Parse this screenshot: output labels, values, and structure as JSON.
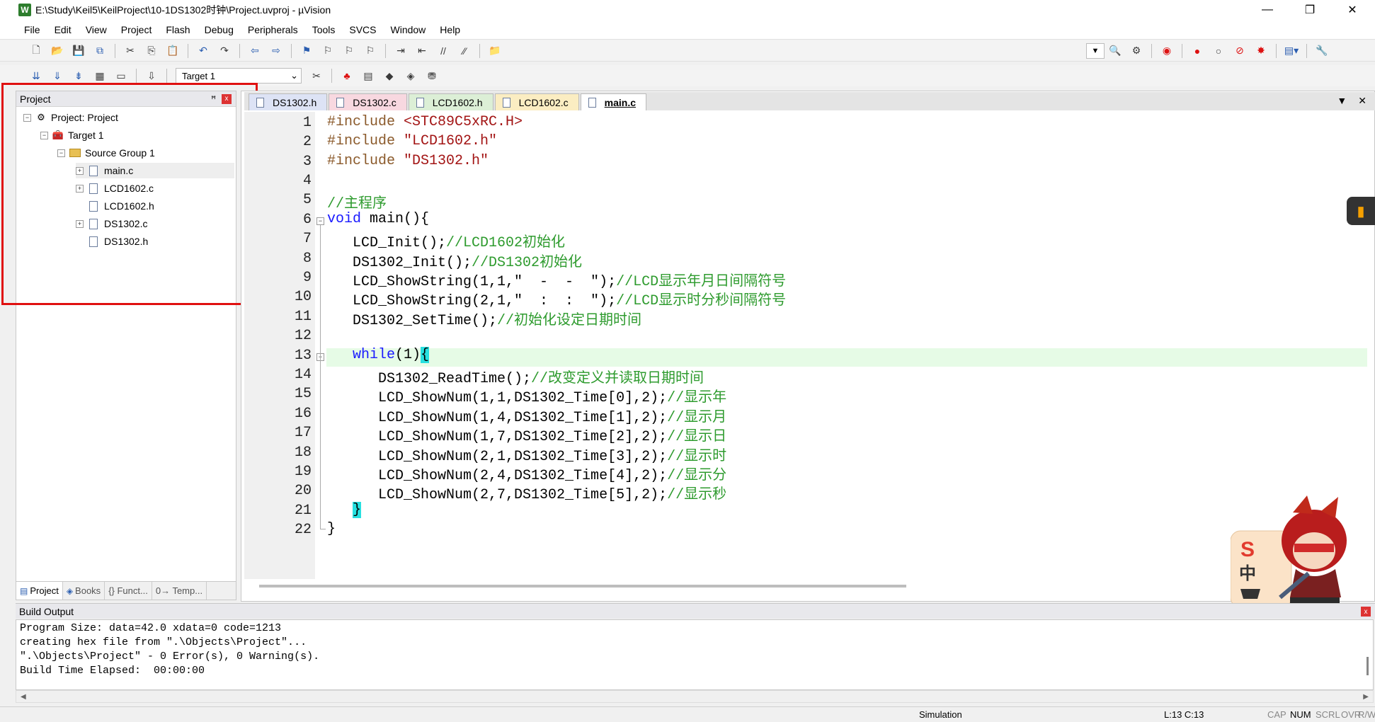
{
  "window": {
    "title": "E:\\Study\\Keil5\\KeilProject\\10-1DS1302时钟\\Project.uvproj - µVision",
    "app_icon": "W",
    "controls": {
      "minimize": "—",
      "maximize": "❐",
      "close": "✕"
    }
  },
  "menu": [
    "File",
    "Edit",
    "View",
    "Project",
    "Flash",
    "Debug",
    "Peripherals",
    "Tools",
    "SVCS",
    "Window",
    "Help"
  ],
  "toolbar": {
    "target": "Target 1"
  },
  "project_panel": {
    "title": "Project",
    "pin": "ꟸ",
    "close": "x",
    "tree": {
      "root": "Project: Project",
      "target": "Target 1",
      "group": "Source Group 1",
      "files": [
        "main.c",
        "LCD1602.c",
        "LCD1602.h",
        "DS1302.c",
        "DS1302.h"
      ]
    },
    "bottom_tabs": [
      "Project",
      "Books",
      "{} Funct...",
      "0→ Temp..."
    ]
  },
  "editor": {
    "tabs": [
      "DS1302.h",
      "DS1302.c",
      "LCD1602.h",
      "LCD1602.c",
      "main.c"
    ],
    "active_tab": "main.c",
    "line_numbers": [
      "1",
      "2",
      "3",
      "4",
      "5",
      "6",
      "7",
      "8",
      "9",
      "10",
      "11",
      "12",
      "13",
      "14",
      "15",
      "16",
      "17",
      "18",
      "19",
      "20",
      "21",
      "22"
    ],
    "code": {
      "l1_pp": "#include ",
      "l1_str": "<STC89C5xRC.H>",
      "l2_pp": "#include ",
      "l2_str": "\"LCD1602.h\"",
      "l3_pp": "#include ",
      "l3_str": "\"DS1302.h\"",
      "l5_cmt": "//主程序",
      "l6_kw": "void",
      "l6_rest": " main(){",
      "l7_code": "   LCD_Init();",
      "l7_cmt": "//LCD1602初始化",
      "l8_code": "   DS1302_Init();",
      "l8_cmt": "//DS1302初始化",
      "l9_code": "   LCD_ShowString(1,1,\"  -  -  \");",
      "l9_cmt": "//LCD显示年月日间隔符号",
      "l10_code": "   LCD_ShowString(2,1,\"  :  :  \");",
      "l10_cmt": "//LCD显示时分秒间隔符号",
      "l11_code": "   DS1302_SetTime();",
      "l11_cmt": "//初始化设定日期时间",
      "l13_kw": "   while",
      "l13_rest": "(1)",
      "l13_brace": "{",
      "l14_code": "      DS1302_ReadTime();",
      "l14_cmt": "//改变定义并读取日期时间",
      "l15_code": "      LCD_ShowNum(1,1,DS1302_Time[0],2);",
      "l15_cmt": "//显示年",
      "l16_code": "      LCD_ShowNum(1,4,DS1302_Time[1],2);",
      "l16_cmt": "//显示月",
      "l17_code": "      LCD_ShowNum(1,7,DS1302_Time[2],2);",
      "l17_cmt": "//显示日",
      "l18_code": "      LCD_ShowNum(2,1,DS1302_Time[3],2);",
      "l18_cmt": "//显示时",
      "l19_code": "      LCD_ShowNum(2,4,DS1302_Time[4],2);",
      "l19_cmt": "//显示分",
      "l20_code": "      LCD_ShowNum(2,7,DS1302_Time[5],2);",
      "l20_cmt": "//显示秒",
      "l21_pre": "   ",
      "l21_brace": "}",
      "l22": "}"
    }
  },
  "build_output": {
    "title": "Build Output",
    "lines": [
      "Program Size: data=42.0 xdata=0 code=1213",
      "creating hex file from \".\\Objects\\Project\"...",
      "\".\\Objects\\Project\" - 0 Error(s), 0 Warning(s).",
      "Build Time Elapsed:  00:00:00"
    ]
  },
  "statusbar": {
    "mode": "Simulation",
    "position": "L:13 C:13",
    "indicators": [
      "CAP",
      "NUM",
      "SCRL",
      "OVR",
      "R/W"
    ]
  },
  "ime_widget": {
    "symbol": "中"
  }
}
